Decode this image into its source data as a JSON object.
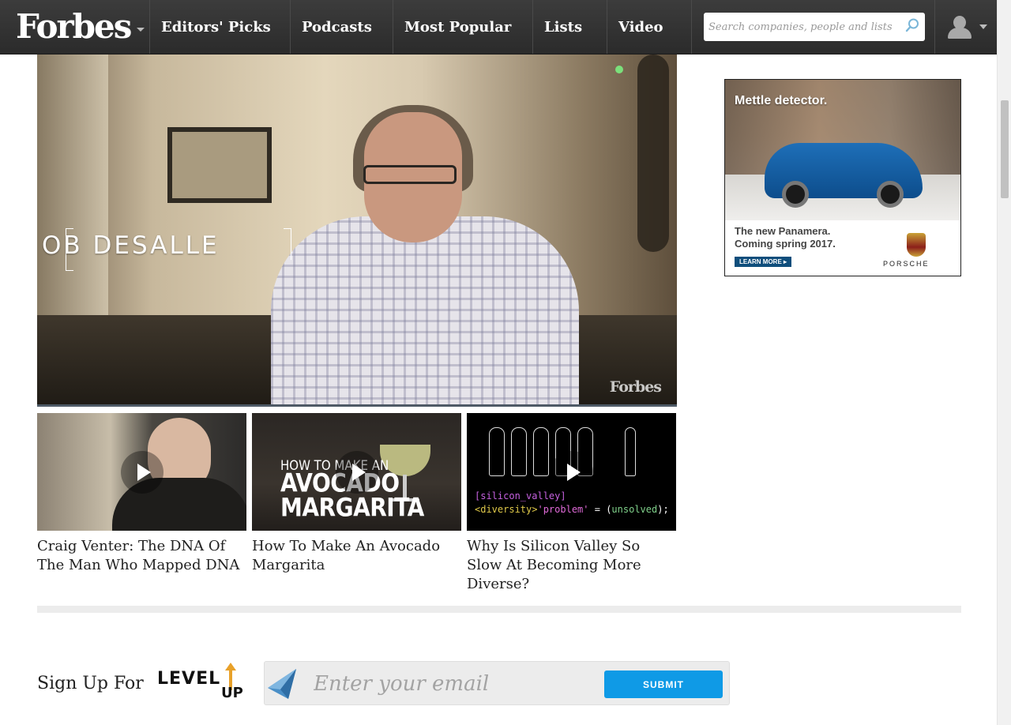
{
  "nav": {
    "logo": "Forbes",
    "items": [
      {
        "label": "Editors' Picks"
      },
      {
        "label": "Podcasts"
      },
      {
        "label": "Most Popular"
      },
      {
        "label": "Lists"
      },
      {
        "label": "Video"
      }
    ],
    "search_placeholder": "Search companies, people and lists"
  },
  "hero": {
    "lower_third": "OB DESALLE",
    "watermark": "Forbes"
  },
  "related": [
    {
      "title": "Craig Venter: The DNA Of The Man Who Mapped DNA"
    },
    {
      "title": "How To Make An Avocado Margarita",
      "thumb_line1": "HOW TO MAKE AN",
      "thumb_line2": "AVOCADO",
      "thumb_line3": "MARGARITA"
    },
    {
      "title": "Why Is Silicon Valley So Slow At Becoming More Diverse?",
      "code_line1": "[silicon_valley]",
      "code_line2_a": "<diversity>",
      "code_line2_b": "'problem'",
      "code_line2_c": " = (",
      "code_line2_d": "unsolved",
      "code_line2_e": ");"
    }
  ],
  "ad": {
    "headline": "Mettle detector.",
    "body_line1": "The new Panamera.",
    "body_line2": "Coming spring 2017.",
    "cta": "LEARN MORE ▸",
    "brand": "PORSCHE"
  },
  "newsletter": {
    "label": "Sign Up For",
    "logo_text": "LEVEL",
    "logo_up": "UP",
    "email_placeholder": "Enter your email",
    "submit_label": "SUBMIT"
  },
  "colors": {
    "nav_bg": "#2f2f2f",
    "submit_blue": "#0f9ae6",
    "ad_cta": "#0f4e7c"
  }
}
